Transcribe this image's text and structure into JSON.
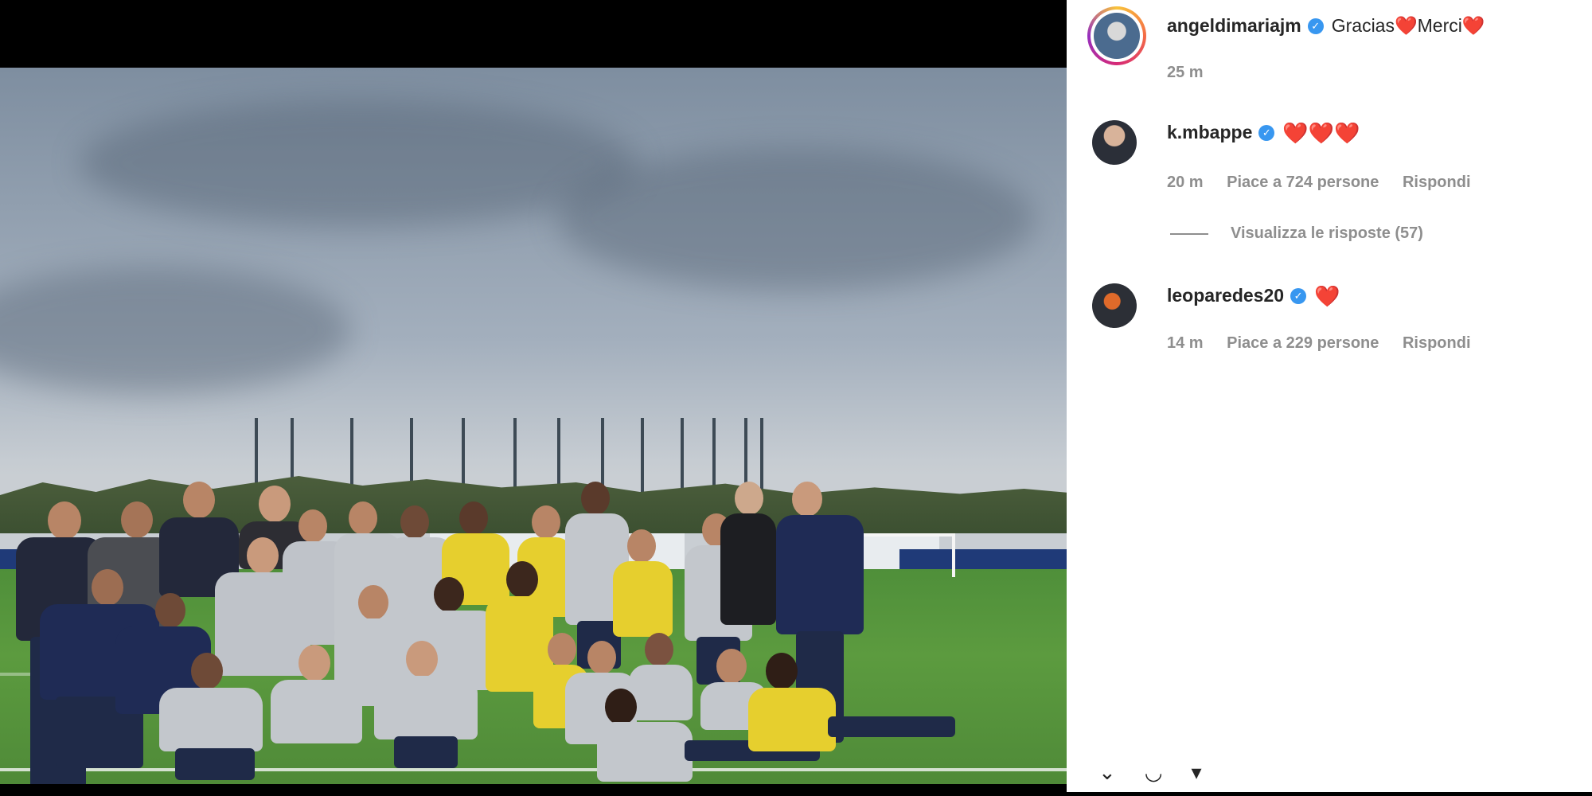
{
  "post": {
    "author": "angeldimariajm",
    "caption": "Gracias❤️Merci❤️",
    "time": "25 m"
  },
  "comments": [
    {
      "username": "k.mbappe",
      "text": "❤️❤️❤️",
      "time": "20 m",
      "likes": "Piace a 724 persone",
      "reply": "Rispondi",
      "view_replies": "Visualizza le risposte (57)"
    },
    {
      "username": "leoparedes20",
      "text": "❤️",
      "time": "14 m",
      "likes": "Piace a 229 persone",
      "reply": "Rispondi"
    }
  ],
  "icons": {
    "verified": "verified-badge-icon",
    "actions": [
      "chevron-down-icon",
      "share-icon",
      "bookmark-icon"
    ]
  },
  "colors": {
    "verified": "#3897f0",
    "heart": "#e0142a",
    "meta_text": "#8e8e8e",
    "username_text": "#262626"
  }
}
